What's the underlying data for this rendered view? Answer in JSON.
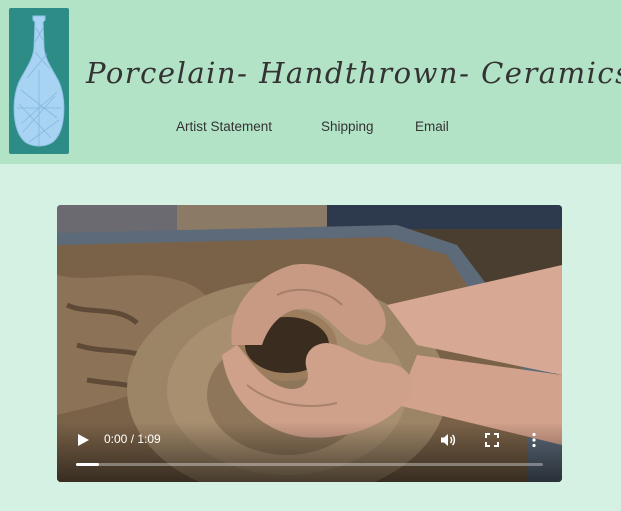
{
  "header": {
    "logo_icon": "vase-logo-icon",
    "title": "Porcelain- Handthrown- Ceramics",
    "nav": [
      {
        "label": "Artist Statement"
      },
      {
        "label": "Shipping"
      },
      {
        "label": "Email"
      }
    ]
  },
  "video": {
    "time_display": "0:00 / 1:09",
    "progress": 0.0,
    "buffered": 0.05,
    "icons": {
      "play": "play-icon",
      "volume": "volume-icon",
      "fullscreen": "fullscreen-icon",
      "more": "more-options-icon"
    }
  },
  "colors": {
    "page_background": "#d5f1e3",
    "header_background": "#b3e3c6",
    "logo_background": "#2e8c87",
    "vase": "#a9d3f2"
  }
}
